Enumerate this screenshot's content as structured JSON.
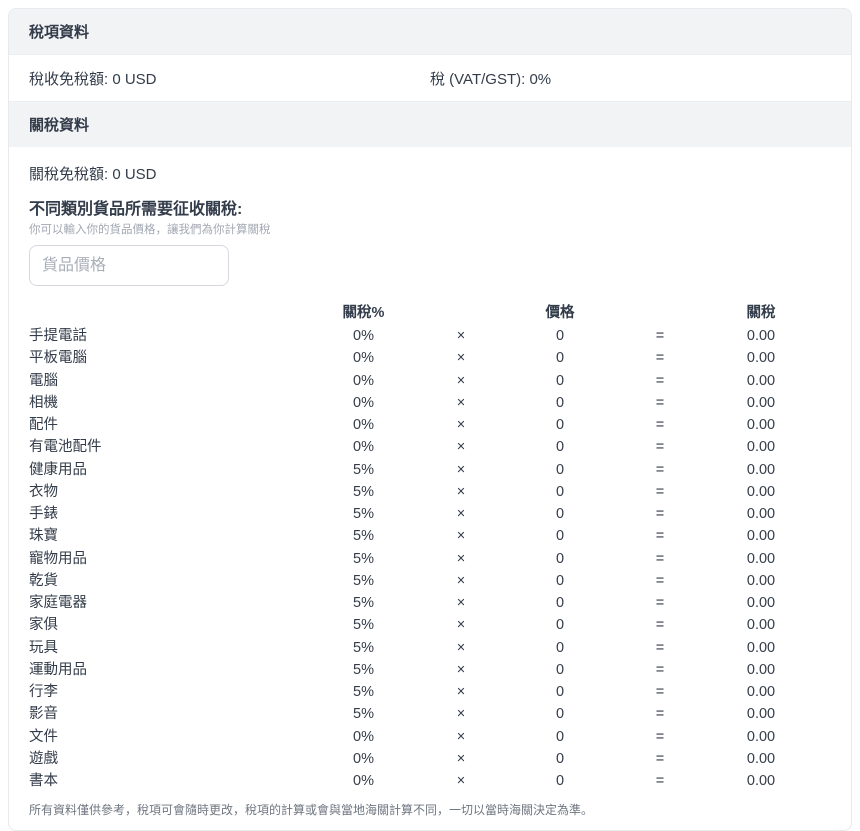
{
  "tax_section": {
    "title": "稅項資料",
    "allowance_label": "稅收免稅額: 0 USD",
    "vat_label": "稅 (VAT/GST): 0%"
  },
  "duty_section": {
    "title": "關稅資料",
    "allowance_label": "關稅免稅額: 0 USD",
    "calc_heading": "不同類別貨品所需要征收關稅:",
    "calc_hint": "你可以輸入你的貨品價格，讓我們為你計算關稅",
    "price_input_placeholder": "貨品價格",
    "table": {
      "headers": {
        "rate": "關稅%",
        "price": "價格",
        "duty": "關稅"
      },
      "multiply_symbol": "×",
      "equals_symbol": "=",
      "rows": [
        {
          "category": "手提電話",
          "rate": "0%",
          "price": "0",
          "duty": "0.00"
        },
        {
          "category": "平板電腦",
          "rate": "0%",
          "price": "0",
          "duty": "0.00"
        },
        {
          "category": "電腦",
          "rate": "0%",
          "price": "0",
          "duty": "0.00"
        },
        {
          "category": "相機",
          "rate": "0%",
          "price": "0",
          "duty": "0.00"
        },
        {
          "category": "配件",
          "rate": "0%",
          "price": "0",
          "duty": "0.00"
        },
        {
          "category": "有電池配件",
          "rate": "0%",
          "price": "0",
          "duty": "0.00"
        },
        {
          "category": "健康用品",
          "rate": "5%",
          "price": "0",
          "duty": "0.00"
        },
        {
          "category": "衣物",
          "rate": "5%",
          "price": "0",
          "duty": "0.00"
        },
        {
          "category": "手錶",
          "rate": "5%",
          "price": "0",
          "duty": "0.00"
        },
        {
          "category": "珠寶",
          "rate": "5%",
          "price": "0",
          "duty": "0.00"
        },
        {
          "category": "寵物用品",
          "rate": "5%",
          "price": "0",
          "duty": "0.00"
        },
        {
          "category": "乾貨",
          "rate": "5%",
          "price": "0",
          "duty": "0.00"
        },
        {
          "category": "家庭電器",
          "rate": "5%",
          "price": "0",
          "duty": "0.00"
        },
        {
          "category": "家俱",
          "rate": "5%",
          "price": "0",
          "duty": "0.00"
        },
        {
          "category": "玩具",
          "rate": "5%",
          "price": "0",
          "duty": "0.00"
        },
        {
          "category": "運動用品",
          "rate": "5%",
          "price": "0",
          "duty": "0.00"
        },
        {
          "category": "行李",
          "rate": "5%",
          "price": "0",
          "duty": "0.00"
        },
        {
          "category": "影音",
          "rate": "5%",
          "price": "0",
          "duty": "0.00"
        },
        {
          "category": "文件",
          "rate": "0%",
          "price": "0",
          "duty": "0.00"
        },
        {
          "category": "遊戲",
          "rate": "0%",
          "price": "0",
          "duty": "0.00"
        },
        {
          "category": "書本",
          "rate": "0%",
          "price": "0",
          "duty": "0.00"
        }
      ]
    },
    "disclaimer": "所有資料僅供參考，稅項可會隨時更改，稅項的計算或會與當地海關計算不同，一切以當時海關決定為準。"
  },
  "colors": {
    "section_bar_bg": "#f2f3f5",
    "border": "#e7e9ec",
    "text": "#333c4a",
    "hint_text": "#a2a8b3",
    "disclaimer_text": "#6f7680"
  }
}
